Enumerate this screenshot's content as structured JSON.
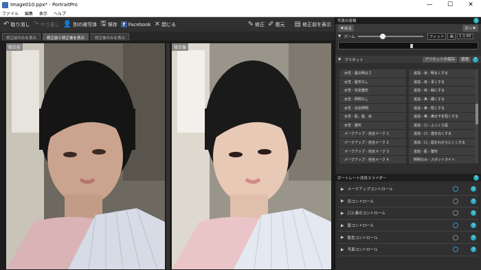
{
  "title": {
    "text": "Image010.ppx* - PortraitPro",
    "minimize": "—",
    "maximize": "☐",
    "close": "✕"
  },
  "menu": [
    "ファイル",
    "編集",
    "表示",
    "ヘルプ"
  ],
  "toolbar": {
    "undo": "取り消し",
    "redo": "やり直し",
    "other_subject": "別の被写体",
    "save": "保存",
    "facebook": "Facebook",
    "close": "閉じる",
    "correct": "修正",
    "restore": "復元",
    "show_before": "修正前を表示"
  },
  "tabs": [
    "修正前のみを表示",
    "修正前と修正後を表示",
    "修正後のみを表示"
  ],
  "panes": {
    "before": "修正前",
    "after": "修正後"
  },
  "panel": {
    "photo_header": "写真の容積",
    "back": "戻る",
    "next": "次へ",
    "zoom_label": "ズーム",
    "fit": "フィット",
    "zoom_mode": "画",
    "zoom_value": "1:1.65",
    "zoom_level": 0.38,
    "preset_header": "プリセット",
    "save_preset": "プリセットの保存",
    "manage": "管理",
    "presets_left": [
      "女性 - 髪の明るさ",
      "女性 - 髪形なし",
      "女性 - 完全整形",
      "女性 - 照明なし",
      "女性 - 完全照明",
      "女性 - 肌、髪、目",
      "女性 - 整形",
      "メークアップ - 完全メーク 1",
      "メークアップ - 完全メーク 2",
      "メークアップ - 完全メーク 3",
      "メークアップ - 完全メーク 4"
    ],
    "presets_right": [
      "追加 - 目 - 明るくする",
      "追加 - 目 - 青くする",
      "追加 - 目 - 緑にする",
      "追加 - 鼻 - 細くする",
      "追加 - 鼻 - 短くする",
      "追加 - 鼻 - 鼻の下を短くする",
      "追加 - 口 - ふっくら唇",
      "追加 - 口 - 歯を白くする",
      "追加 - 口 - 唇をわからにくくする",
      "追加 - 肌 - 整形",
      "照明のみ - スポットライト"
    ],
    "sliders_header": "ポートレート改良スライダー",
    "controls": [
      {
        "label": "メークアップコントロール",
        "on": true
      },
      {
        "label": "目コントロール",
        "on": false
      },
      {
        "label": "口と鼻のコントロール",
        "on": false
      },
      {
        "label": "髪コントロール",
        "on": true
      },
      {
        "label": "肌色コントロール",
        "on": false
      },
      {
        "label": "写真コントロール",
        "on": true
      }
    ]
  },
  "colors": {
    "accent": "#2aa8c0",
    "facebook": "#3b5998"
  }
}
